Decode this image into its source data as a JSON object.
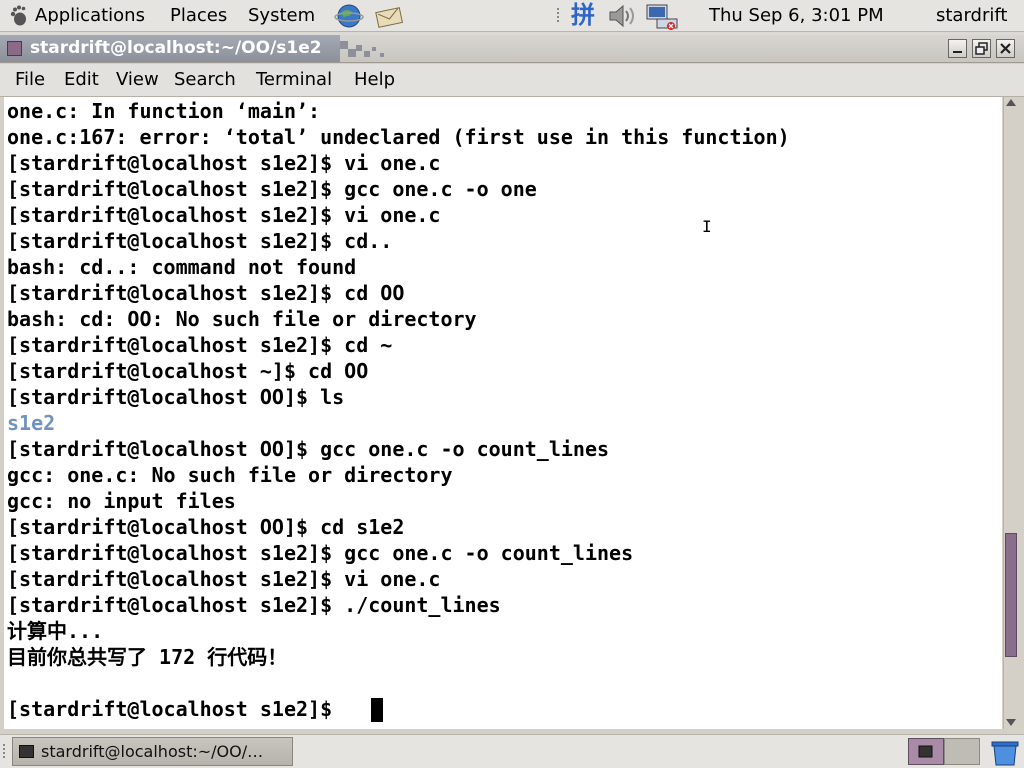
{
  "top_panel": {
    "menus": [
      "Applications",
      "Places",
      "System"
    ],
    "clock": "Thu Sep  6,  3:01 PM",
    "user": "stardrift",
    "input_method_label": "拼"
  },
  "window": {
    "title": "stardrift@localhost:~/OO/s1e2",
    "menus": [
      "File",
      "Edit",
      "View",
      "Search",
      "Terminal",
      "Help"
    ]
  },
  "terminal": {
    "lines": [
      "one.c: In function ‘main’:",
      "one.c:167: error: ‘total’ undeclared (first use in this function)",
      "[stardrift@localhost s1e2]$ vi one.c",
      "[stardrift@localhost s1e2]$ gcc one.c -o one",
      "[stardrift@localhost s1e2]$ vi one.c",
      "[stardrift@localhost s1e2]$ cd..",
      "bash: cd..: command not found",
      "[stardrift@localhost s1e2]$ cd OO",
      "bash: cd: OO: No such file or directory",
      "[stardrift@localhost s1e2]$ cd ~",
      "[stardrift@localhost ~]$ cd OO",
      "[stardrift@localhost OO]$ ls",
      "s1e2",
      "[stardrift@localhost OO]$ gcc one.c -o count_lines",
      "gcc: one.c: No such file or directory",
      "gcc: no input files",
      "[stardrift@localhost OO]$ cd s1e2",
      "[stardrift@localhost s1e2]$ gcc one.c -o count_lines",
      "[stardrift@localhost s1e2]$ vi one.c",
      "[stardrift@localhost s1e2]$ ./count_lines",
      "计算中...",
      "目前你总共写了 172 行代码！",
      "",
      "[stardrift@localhost s1e2]$ "
    ],
    "scroll_position": 0.88
  },
  "bottom_panel": {
    "task_label": "stardrift@localhost:~/OO/…"
  }
}
